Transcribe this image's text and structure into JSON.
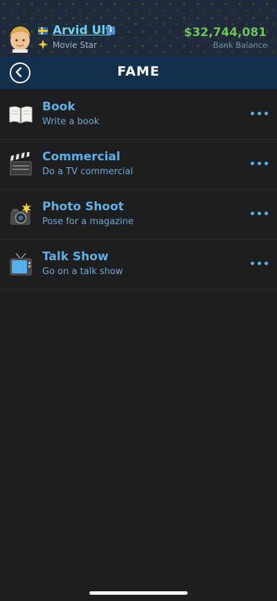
{
  "profile": {
    "name": "Arvid Ulf",
    "title": "Movie Star",
    "balance": "$32,744,081",
    "balance_label": "Bank Balance"
  },
  "header": {
    "title": "FAME"
  },
  "activities": [
    {
      "title": "Book",
      "subtitle": "Write a book",
      "icon": "book-icon"
    },
    {
      "title": "Commercial",
      "subtitle": "Do a TV commercial",
      "icon": "clapperboard-icon"
    },
    {
      "title": "Photo Shoot",
      "subtitle": "Pose for a magazine",
      "icon": "camera-flash-icon"
    },
    {
      "title": "Talk Show",
      "subtitle": "Go on a talk show",
      "icon": "television-icon"
    }
  ],
  "colors": {
    "accent": "#5cb2e8",
    "money": "#6dc55a",
    "header_bg": "#13304f",
    "background": "#1e1e20"
  }
}
